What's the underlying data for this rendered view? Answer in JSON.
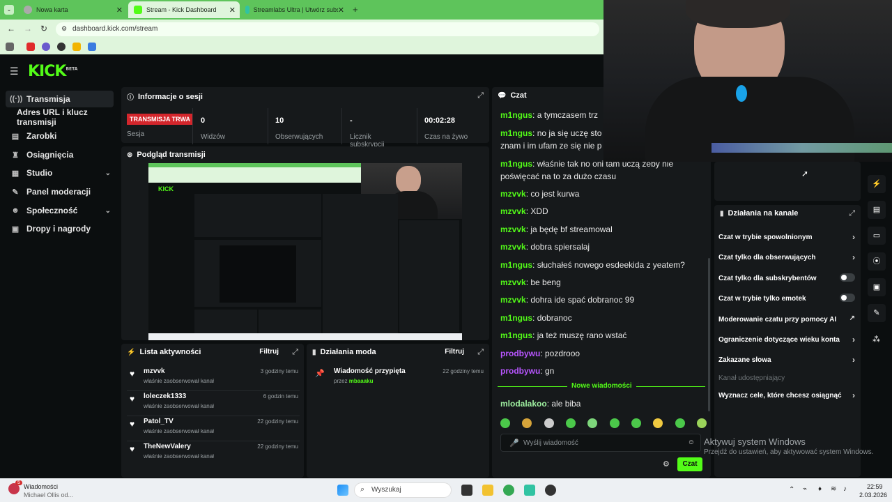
{
  "browser": {
    "tabs": [
      {
        "label": "Nowa karta"
      },
      {
        "label": "Stream - Kick Dashboard"
      },
      {
        "label": "Streamlabs Ultra | Utwórz subsk"
      }
    ],
    "url": "dashboard.kick.com/stream",
    "new_tab": "+"
  },
  "app": {
    "logo": "KICK",
    "logo_badge": "BETA"
  },
  "sidebar": {
    "items": [
      {
        "label": "Transmisja",
        "icon": "broadcast-icon"
      },
      {
        "label": "Adres URL i klucz transmisji"
      },
      {
        "label": "Zarobki",
        "icon": "earnings-icon"
      },
      {
        "label": "Osiągnięcia",
        "icon": "trophy-icon"
      },
      {
        "label": "Studio",
        "icon": "studio-icon"
      },
      {
        "label": "Panel moderacji",
        "icon": "wrench-icon"
      },
      {
        "label": "Społeczność",
        "icon": "community-icon"
      },
      {
        "label": "Dropy i nagrody",
        "icon": "gift-icon"
      }
    ]
  },
  "session": {
    "title": "Informacje o sesji",
    "badge": "TRANSMISJA TRWA",
    "badge_label": "Sesja",
    "stats": [
      {
        "value": "0",
        "label": "Widzów"
      },
      {
        "value": "10",
        "label": "Obserwujących"
      },
      {
        "value": "-",
        "label": "Licznik subskrypcji"
      },
      {
        "value": "00:02:28",
        "label": "Czas na żywo"
      }
    ]
  },
  "preview": {
    "title": "Podgląd transmisji"
  },
  "activity": {
    "title": "Lista aktywności",
    "filter": "Filtruj",
    "items": [
      {
        "name": "mzvvk",
        "desc": "właśnie zaobserwował kanał",
        "time": "3 godziny temu"
      },
      {
        "name": "loleczek1333",
        "desc": "właśnie zaobserwował kanał",
        "time": "6 godzin temu"
      },
      {
        "name": "Patol_TV",
        "desc": "właśnie zaobserwował kanał",
        "time": "22 godziny temu"
      },
      {
        "name": "TheNewValery",
        "desc": "właśnie zaobserwował kanał",
        "time": "22 godziny temu"
      }
    ]
  },
  "mod": {
    "title": "Działania moda",
    "filter": "Filtruj",
    "items": [
      {
        "title": "Wiadomość przypięta",
        "by_prefix": "przez",
        "by": "mbaaaku",
        "time": "22 godziny temu"
      }
    ]
  },
  "chat": {
    "title": "Czat",
    "messages": [
      {
        "user": "m1ngus",
        "text": "a tymczasem trz",
        "color": "#53fc18"
      },
      {
        "user": "m1ngus",
        "text": "no ja się uczę sto",
        "text2": "znam i im ufam ze się nie p",
        "color": "#53fc18"
      },
      {
        "user": "m1ngus",
        "text": "właśnie tak no oni tam uczą żeby nie",
        "text2": "poświęcać na to za dużo czasu",
        "color": "#53fc18"
      },
      {
        "user": "mzvvk",
        "text": "co jest kurwa",
        "color": "#53fc18"
      },
      {
        "user": "mzvvk",
        "text": "XDD",
        "color": "#53fc18"
      },
      {
        "user": "mzvvk",
        "text": "ja będę bf streamowal",
        "color": "#53fc18"
      },
      {
        "user": "mzvvk",
        "text": "dobra spiersalaj",
        "color": "#53fc18"
      },
      {
        "user": "m1ngus",
        "text": "słuchałeś nowego esdeekida z yeatem?",
        "color": "#53fc18"
      },
      {
        "user": "mzvvk",
        "text": "be beng",
        "color": "#53fc18"
      },
      {
        "user": "mzvvk",
        "text": "dohra ide spać dobranoc 99",
        "color": "#53fc18"
      },
      {
        "user": "m1ngus",
        "text": "dobranoc",
        "color": "#53fc18"
      },
      {
        "user": "m1ngus",
        "text": "ja też muszę rano wstać",
        "color": "#53fc18"
      },
      {
        "user": "prodbywu",
        "text": "pozdrooo",
        "color": "#b855ff"
      },
      {
        "user": "prodbywu",
        "text": "gn",
        "color": "#b855ff"
      }
    ],
    "new_messages": "Nowe wiadomości",
    "last": {
      "user": "mlodalakoo",
      "text": "ale biba"
    },
    "placeholder": "Wyślij wiadomość",
    "send": "Czat"
  },
  "channel_actions": {
    "title": "Działania na kanale",
    "items": [
      {
        "label": "Czat w trybie spowolnionym",
        "control": "chevron"
      },
      {
        "label": "Czat tylko dla obserwujących",
        "control": "chevron"
      },
      {
        "label": "Czat tylko dla subskrybentów",
        "control": "toggle"
      },
      {
        "label": "Czat w trybie tylko emotek",
        "control": "toggle"
      },
      {
        "label": "Moderowanie czatu przy pomocy AI",
        "control": "external"
      },
      {
        "label": "Ograniczenie dotyczące wieku konta",
        "control": "chevron"
      },
      {
        "label": "Zakazane słowa",
        "control": "chevron"
      },
      {
        "label": "Kanał udostępniający",
        "control": "none"
      },
      {
        "label": "Wyznacz cele, które chcesz osiągnąć",
        "control": "chevron"
      }
    ]
  },
  "watermark": {
    "line1": "Aktywuj system Windows",
    "line2": "Przejdź do ustawień, aby aktywować system Windows."
  },
  "taskbar": {
    "notif_title": "Wiadomości",
    "notif_sub": "Michael Ollis od...",
    "notif_count": "5",
    "search": "Wyszukaj",
    "time": "22:59",
    "date": "2.03.2026"
  }
}
